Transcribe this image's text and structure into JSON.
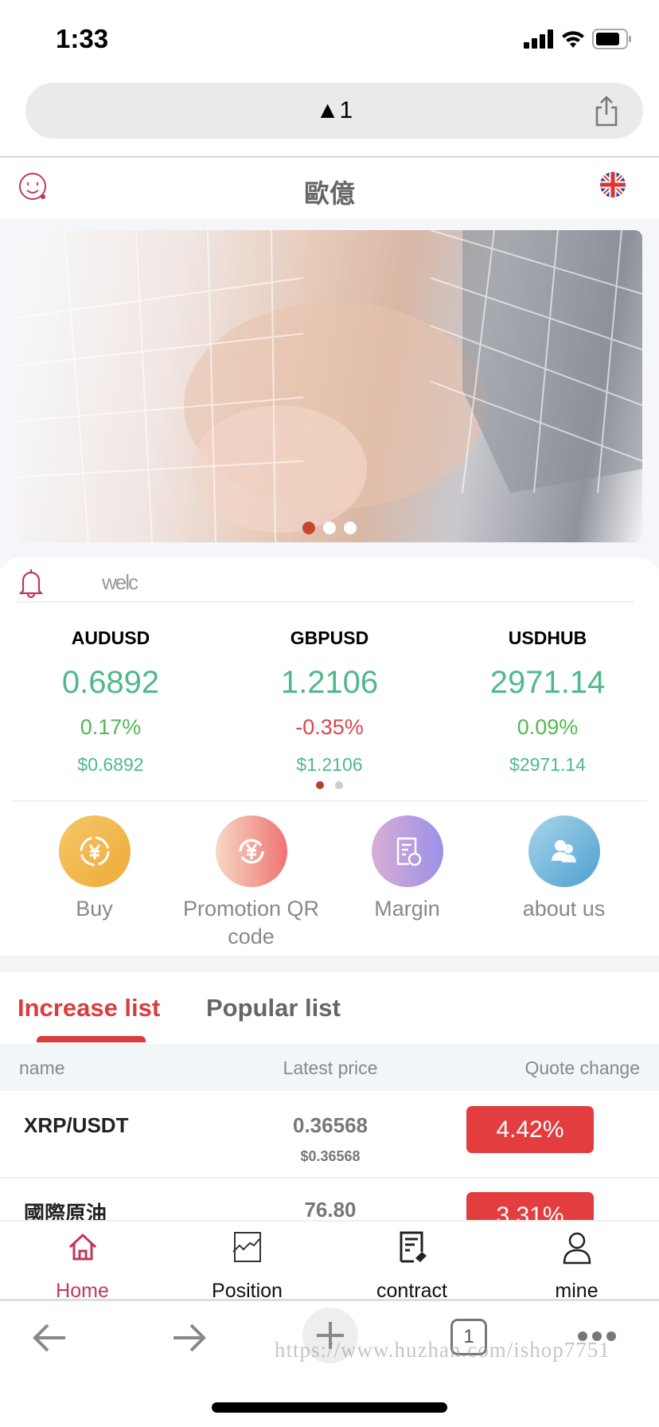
{
  "status_bar": {
    "time": "1:33"
  },
  "browser": {
    "url": "1",
    "tab_count": "1"
  },
  "header": {
    "title": "歐億"
  },
  "banner": {
    "slide_count": 3,
    "active_slide": 1
  },
  "notice": {
    "text": "welc"
  },
  "tickers": [
    {
      "name": "AUDUSD",
      "price": "0.6892",
      "change": "0.17%",
      "usd": "$0.6892",
      "direction": "up"
    },
    {
      "name": "GBPUSD",
      "price": "1.2106",
      "change": "-0.35%",
      "usd": "$1.2106",
      "direction": "down"
    },
    {
      "name": "USDHUB",
      "price": "2971.14",
      "change": "0.09%",
      "usd": "$2971.14",
      "direction": "up"
    }
  ],
  "ticker_pages": {
    "count": 2,
    "active": 1
  },
  "quick_links": [
    {
      "label": "Buy",
      "icon": "yen-exchange-icon"
    },
    {
      "label": "Promotion QR code",
      "icon": "yen-refresh-icon"
    },
    {
      "label": "Margin",
      "icon": "document-badge-icon"
    },
    {
      "label": "about us",
      "icon": "users-icon"
    }
  ],
  "list_tabs": [
    {
      "label": "Increase list",
      "active": true
    },
    {
      "label": "Popular list",
      "active": false
    }
  ],
  "table": {
    "headers": [
      "name",
      "Latest price",
      "Quote change"
    ],
    "rows": [
      {
        "name": "XRP/USDT",
        "price": "0.36568",
        "usd": "$0.36568",
        "change": "4.42%"
      },
      {
        "name": "國際原油",
        "price": "76.80",
        "usd": "",
        "change": "3.31%"
      }
    ]
  },
  "tabbar": [
    {
      "label": "Home",
      "icon": "home-icon",
      "active": true
    },
    {
      "label": "Position",
      "icon": "chart-icon",
      "active": false
    },
    {
      "label": "contract",
      "icon": "contract-icon",
      "active": false
    },
    {
      "label": "mine",
      "icon": "user-icon",
      "active": false
    }
  ],
  "watermark": "https://www.huzhan.com/ishop7751",
  "colors": {
    "accent": "#dc3c3c",
    "up": "#4fb98c",
    "down": "#d8474f",
    "badge": "#e33d3f",
    "home_active": "#c0395a"
  }
}
